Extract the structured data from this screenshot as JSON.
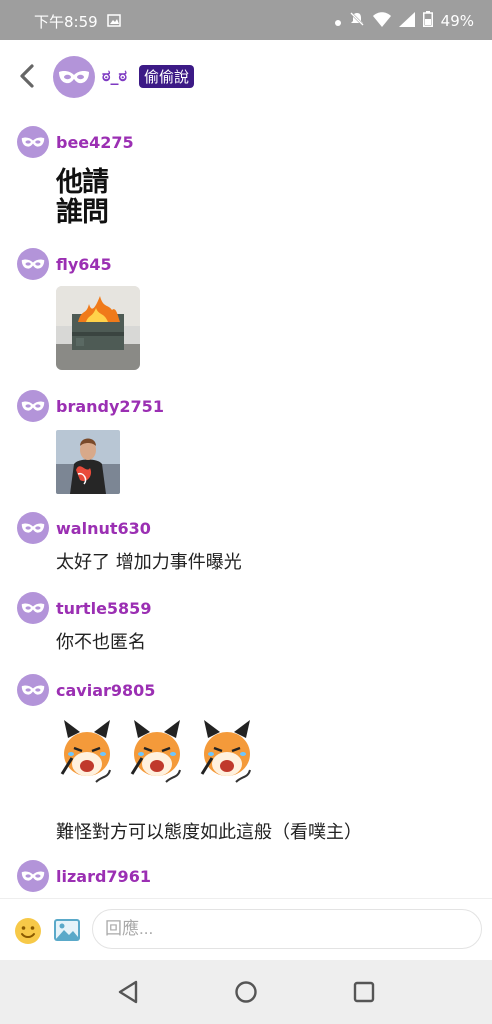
{
  "status": {
    "time": "下午8:59",
    "battery": "49%"
  },
  "header": {
    "title": "ಠ_ಠ",
    "badge": "偷偷說"
  },
  "comments": [
    {
      "user": "bee4275",
      "sticker_text": [
        "他請",
        "誰問"
      ]
    },
    {
      "user": "fly645",
      "image": "burning-dumpster"
    },
    {
      "user": "brandy2751",
      "image": "person-holding-phone"
    },
    {
      "user": "walnut630",
      "text": "太好了 增加力事件曝光"
    },
    {
      "user": "turtle5859",
      "text": "你不也匿名"
    },
    {
      "user": "caviar9805",
      "stickers": [
        "crying-fox",
        "crying-fox",
        "crying-fox"
      ],
      "text": "難怪對方可以態度如此這般（看噗主）"
    },
    {
      "user": "lizard7961"
    }
  ],
  "reply": {
    "placeholder": "回應..."
  },
  "icons": {
    "back": "back-arrow-icon",
    "avatar": "mask-icon",
    "emoji": "emoji-icon",
    "image": "image-icon",
    "nav": [
      "nav-back-icon",
      "nav-home-icon",
      "nav-recents-icon"
    ]
  },
  "colors": {
    "username": "#9b2fb3",
    "badge": "#3c1a86",
    "avatar": "#b394d9",
    "statusbar": "#9e9e9e"
  }
}
